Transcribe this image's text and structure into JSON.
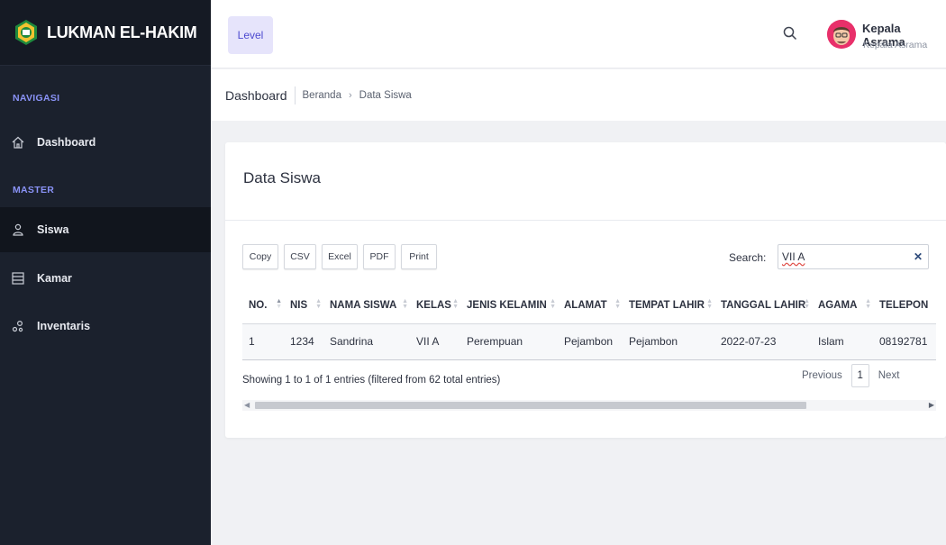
{
  "brand": {
    "name": "LUKMAN EL-HAKIM"
  },
  "sidebar": {
    "sections": {
      "navigasi": "NAVIGASI",
      "master": "MASTER"
    },
    "items": [
      {
        "label": "Dashboard",
        "icon": "home-icon"
      },
      {
        "label": "Siswa",
        "icon": "user-icon",
        "active": true
      },
      {
        "label": "Kamar",
        "icon": "list-icon"
      },
      {
        "label": "Inventaris",
        "icon": "nodes-icon"
      }
    ]
  },
  "header": {
    "level_label": "Level",
    "user_name": "Kepala Asrama",
    "user_role": "Kepala Asrama"
  },
  "breadcrumb": {
    "title": "Dashboard",
    "items": [
      "Beranda",
      "Data Siswa"
    ]
  },
  "card": {
    "title": "Data Siswa"
  },
  "export_buttons": [
    "Copy",
    "CSV",
    "Excel",
    "PDF",
    "Print"
  ],
  "search": {
    "label": "Search:",
    "value": "VII A"
  },
  "table": {
    "columns": [
      "NO.",
      "NIS",
      "NAMA SISWA",
      "KELAS",
      "JENIS KELAMIN",
      "ALAMAT",
      "TEMPAT LAHIR",
      "TANGGAL LAHIR",
      "AGAMA",
      "TELEPON"
    ],
    "rows": [
      [
        "1",
        "1234",
        "Sandrina",
        "VII A",
        "Perempuan",
        "Pejambon",
        "Pejambon",
        "2022-07-23",
        "Islam",
        "08192781"
      ]
    ]
  },
  "info": "Showing 1 to 1 of 1 entries (filtered from 62 total entries)",
  "pagination": {
    "previous": "Previous",
    "page": "1",
    "next": "Next"
  },
  "colors": {
    "accent": "#4e4bd0",
    "sidebar_bg": "#1b212d",
    "avatar": "#e8306a"
  }
}
